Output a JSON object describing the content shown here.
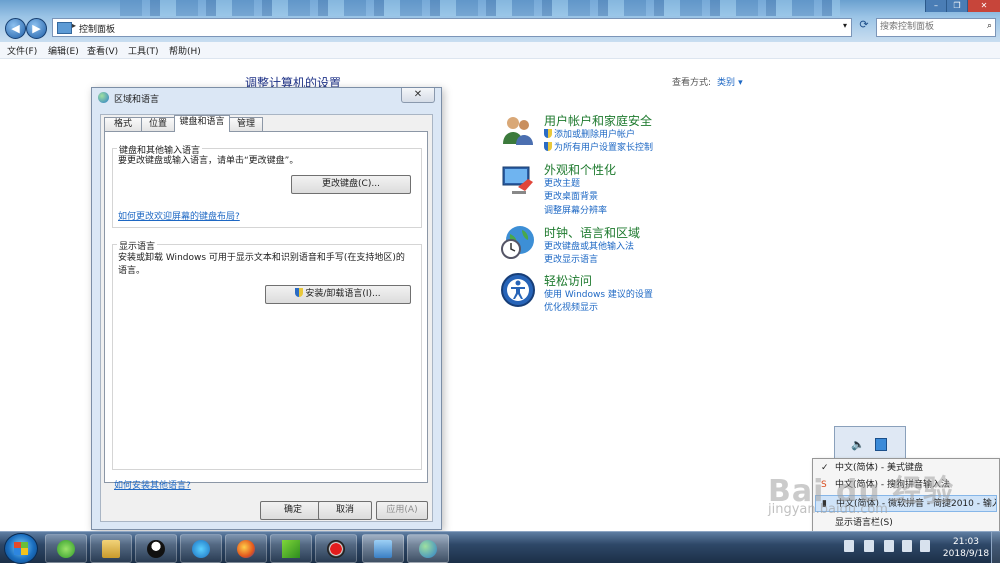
{
  "window": {
    "address_path": "控制面板",
    "search_placeholder": "搜索控制面板"
  },
  "menubar": {
    "items": [
      "文件(F)",
      "编辑(E)",
      "查看(V)",
      "工具(T)",
      "帮助(H)"
    ]
  },
  "main": {
    "title": "调整计算机的设置",
    "view_by_label": "查看方式:",
    "view_by_value": "类别",
    "categories": [
      {
        "title": "用户帐户和家庭安全",
        "links": [
          "添加或删除用户帐户",
          "为所有用户设置家长控制"
        ]
      },
      {
        "title": "外观和个性化",
        "links": [
          "更改主题",
          "更改桌面背景",
          "调整屏幕分辨率"
        ]
      },
      {
        "title": "时钟、语言和区域",
        "links": [
          "更改键盘或其他输入法",
          "更改显示语言"
        ]
      },
      {
        "title": "轻松访问",
        "links": [
          "使用 Windows 建议的设置",
          "优化视频显示"
        ]
      }
    ]
  },
  "dialog": {
    "title": "区域和语言",
    "tabs": [
      "格式",
      "位置",
      "键盘和语言",
      "管理"
    ],
    "active_tab": "键盘和语言",
    "keyboards_group": {
      "label": "键盘和其他输入语言",
      "text": "要更改键盘或输入语言，请单击“更改键盘”。",
      "button": "更改键盘(C)...",
      "link": "如何更改欢迎屏幕的键盘布局?"
    },
    "display_group": {
      "label": "显示语言",
      "text": "安装或卸载 Windows 可用于显示文本和识别语音和手写(在支持地区)的语言。",
      "button": "安装/卸载语言(I)..."
    },
    "bottom_link": "如何安装其他语言?",
    "buttons": {
      "ok": "确定",
      "cancel": "取消",
      "apply": "应用(A)"
    }
  },
  "language_menu": {
    "items": [
      "中文(简体) - 美式键盘",
      "中文(简体) - 搜狗拼音输入法",
      "中文(简体) - 微软拼音 - 简捷2010 - 输入风格",
      "显示语言栏(S)"
    ],
    "checked_index": 0,
    "highlighted_index": 2
  },
  "watermark": {
    "logo": "Bai du 经验",
    "url": "jingyan.baidu.com"
  },
  "taskbar": {
    "apps": [
      "360安全卫士",
      "资源管理器",
      "QQ",
      "视频",
      "Firefox",
      "迅雷",
      "录屏",
      "控制面板",
      "区域和语言"
    ],
    "time": "21:03",
    "date": "2018/9/18"
  }
}
